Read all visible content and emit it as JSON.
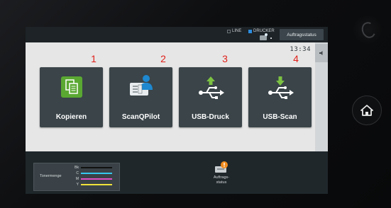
{
  "status_bar": {
    "indicators": [
      {
        "label": "LINE",
        "active": false
      },
      {
        "label": "DRUCKER",
        "active": true
      }
    ],
    "job_status_button": "Auftragsstatus"
  },
  "clock": "13:34",
  "side_panel": {
    "tab_icon": "speaker-icon"
  },
  "annotations": [
    "1",
    "2",
    "3",
    "4"
  ],
  "tiles": [
    {
      "label": "Kopieren",
      "icon": "copy-icon"
    },
    {
      "label": "ScanQPilot",
      "icon": "scanqpilot-icon"
    },
    {
      "label": "USB-Druck",
      "icon": "usb-print-icon"
    },
    {
      "label": "USB-Scan",
      "icon": "usb-scan-icon"
    }
  ],
  "toner": {
    "title": "Tonermenge",
    "rows": [
      {
        "label": "Bk",
        "color": "#111111"
      },
      {
        "label": "C",
        "color": "#35c8f0"
      },
      {
        "label": "M",
        "color": "#e04fc4"
      },
      {
        "label": "Y",
        "color": "#f0e23a"
      }
    ]
  },
  "job_status": {
    "label_line1": "Auftrags-",
    "label_line2": "status"
  },
  "colors": {
    "accent_green": "#5aa832",
    "accent_blue": "#1e88d0",
    "annotation_red": "#e0201a"
  }
}
